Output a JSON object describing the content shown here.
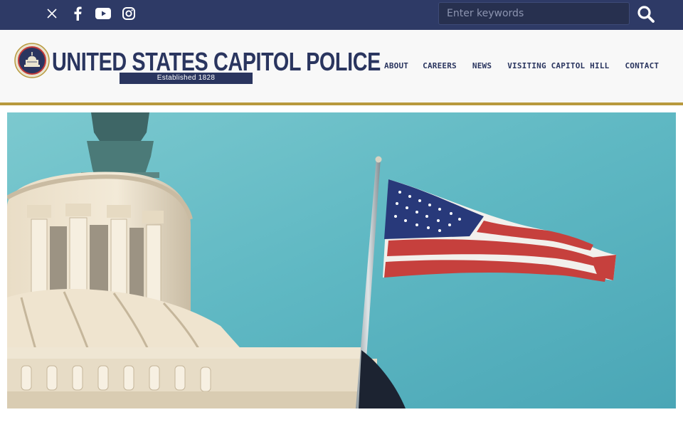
{
  "topbar": {
    "social": [
      {
        "icon": "x-twitter-icon"
      },
      {
        "icon": "facebook-icon"
      },
      {
        "icon": "youtube-icon"
      },
      {
        "icon": "instagram-icon"
      }
    ],
    "search": {
      "placeholder": "Enter keywords",
      "value": ""
    },
    "search_button_icon": "search-icon",
    "background_color": "#2e3a66"
  },
  "header": {
    "logo_title": "UNITED STATES CAPITOL POLICE",
    "established": "Established 1828",
    "accent_color": "#b89a3e",
    "brand_color": "#2a355f"
  },
  "nav": {
    "items": [
      {
        "label": "ABOUT"
      },
      {
        "label": "CAREERS"
      },
      {
        "label": "NEWS"
      },
      {
        "label": "VISITING CAPITOL HILL"
      },
      {
        "label": "CONTACT"
      }
    ]
  },
  "hero": {
    "image": "capitol-dome-and-american-flag"
  }
}
